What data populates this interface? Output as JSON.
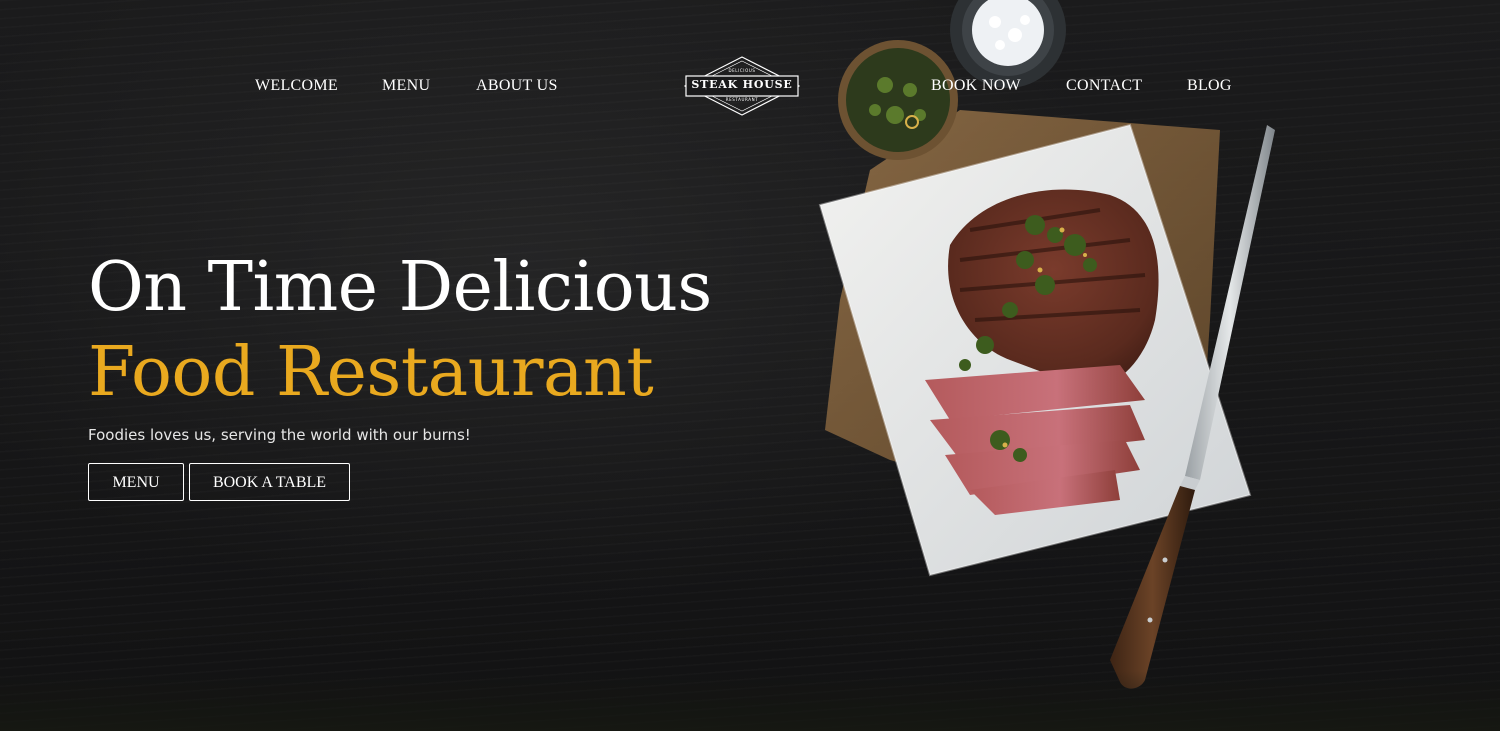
{
  "nav": {
    "left": [
      {
        "label": "WELCOME"
      },
      {
        "label": "MENU"
      },
      {
        "label": "ABOUT US"
      }
    ],
    "right": [
      {
        "label": "BOOK NOW"
      },
      {
        "label": "CONTACT"
      },
      {
        "label": "BLOG"
      }
    ]
  },
  "logo": {
    "top": "DELICIOUS",
    "name": "STEAK HOUSE",
    "bottom": "RESTAURANT"
  },
  "hero": {
    "title_line1": "On Time Delicious",
    "title_line2": "Food Restaurant",
    "subtitle": "Foodies loves us, serving the world with our burns!",
    "buttons": {
      "menu": "MENU",
      "book": "BOOK A TABLE"
    }
  },
  "colors": {
    "accent": "#e9a91f",
    "background": "#171718",
    "text": "#ffffff"
  },
  "icons": {
    "food_image": "steak-on-paper-image",
    "logo_badge": "diamond-badge-logo"
  }
}
